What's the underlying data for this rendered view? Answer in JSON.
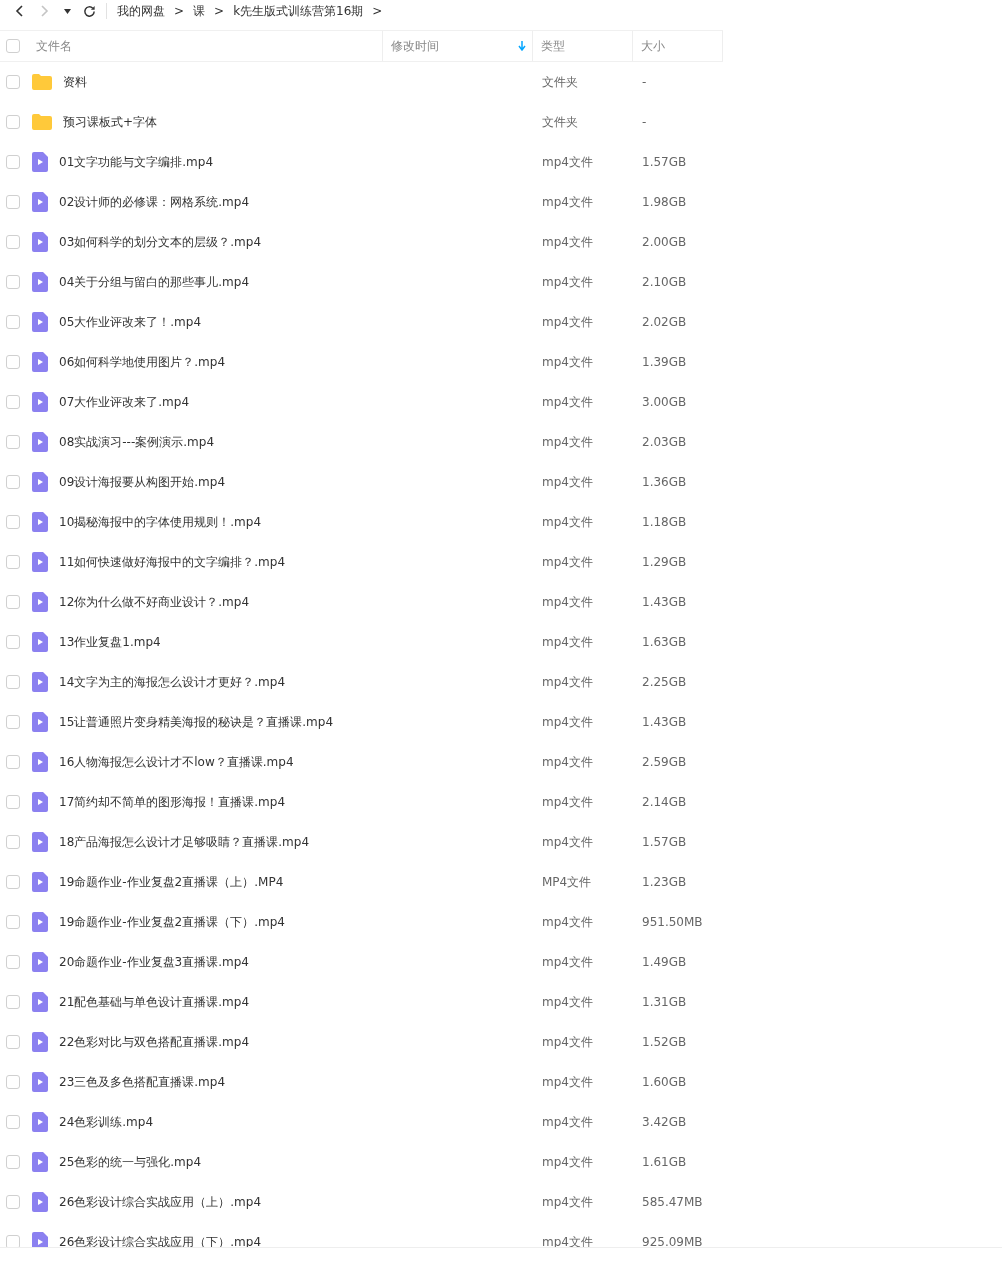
{
  "nav": {
    "back_disabled": false,
    "forward_disabled": true
  },
  "breadcrumb": [
    {
      "label": "我的网盘",
      "separator": ">"
    },
    {
      "label": "课",
      "separator": ">"
    },
    {
      "label": "k先生版式训练营第16期",
      "separator": ">"
    }
  ],
  "table": {
    "all_checked": false,
    "columns": [
      {
        "label": "文件名",
        "sorted": false
      },
      {
        "label": "修改时间",
        "sorted": true
      },
      {
        "label": "类型",
        "sorted": false
      },
      {
        "label": "大小",
        "sorted": false
      }
    ],
    "rows": [
      {
        "kind": "folder",
        "checked": false,
        "name": "资料",
        "type": "文件夹",
        "size": "-"
      },
      {
        "kind": "folder",
        "checked": false,
        "name": "预习课板式+字体",
        "type": "文件夹",
        "size": "-"
      },
      {
        "kind": "video",
        "checked": false,
        "name": "01文字功能与文字编排.mp4",
        "type": "mp4文件",
        "size": "1.57GB"
      },
      {
        "kind": "video",
        "checked": false,
        "name": "02设计师的必修课：网格系统.mp4",
        "type": "mp4文件",
        "size": "1.98GB"
      },
      {
        "kind": "video",
        "checked": false,
        "name": "03如何科学的划分文本的层级？.mp4",
        "type": "mp4文件",
        "size": "2.00GB"
      },
      {
        "kind": "video",
        "checked": false,
        "name": "04关于分组与留白的那些事儿.mp4",
        "type": "mp4文件",
        "size": "2.10GB"
      },
      {
        "kind": "video",
        "checked": false,
        "name": "05大作业评改来了！.mp4",
        "type": "mp4文件",
        "size": "2.02GB"
      },
      {
        "kind": "video",
        "checked": false,
        "name": "06如何科学地使用图片？.mp4",
        "type": "mp4文件",
        "size": "1.39GB"
      },
      {
        "kind": "video",
        "checked": false,
        "name": "07大作业评改来了.mp4",
        "type": "mp4文件",
        "size": "3.00GB"
      },
      {
        "kind": "video",
        "checked": false,
        "name": "08实战演习---案例演示.mp4",
        "type": "mp4文件",
        "size": "2.03GB"
      },
      {
        "kind": "video",
        "checked": false,
        "name": "09设计海报要从构图开始.mp4",
        "type": "mp4文件",
        "size": "1.36GB"
      },
      {
        "kind": "video",
        "checked": false,
        "name": "10揭秘海报中的字体使用规则！.mp4",
        "type": "mp4文件",
        "size": "1.18GB"
      },
      {
        "kind": "video",
        "checked": false,
        "name": "11如何快速做好海报中的文字编排？.mp4",
        "type": "mp4文件",
        "size": "1.29GB"
      },
      {
        "kind": "video",
        "checked": false,
        "name": "12你为什么做不好商业设计？.mp4",
        "type": "mp4文件",
        "size": "1.43GB"
      },
      {
        "kind": "video",
        "checked": false,
        "name": "13作业复盘1.mp4",
        "type": "mp4文件",
        "size": "1.63GB"
      },
      {
        "kind": "video",
        "checked": false,
        "name": "14文字为主的海报怎么设计才更好？.mp4",
        "type": "mp4文件",
        "size": "2.25GB"
      },
      {
        "kind": "video",
        "checked": false,
        "name": "15让普通照片变身精美海报的秘诀是？直播课.mp4",
        "type": "mp4文件",
        "size": "1.43GB"
      },
      {
        "kind": "video",
        "checked": false,
        "name": "16人物海报怎么设计才不low？直播课.mp4",
        "type": "mp4文件",
        "size": "2.59GB"
      },
      {
        "kind": "video",
        "checked": false,
        "name": "17简约却不简单的图形海报！直播课.mp4",
        "type": "mp4文件",
        "size": "2.14GB"
      },
      {
        "kind": "video",
        "checked": false,
        "name": "18产品海报怎么设计才足够吸睛？直播课.mp4",
        "type": "mp4文件",
        "size": "1.57GB"
      },
      {
        "kind": "video",
        "checked": false,
        "name": "19命题作业-作业复盘2直播课（上）.MP4",
        "type": "MP4文件",
        "size": "1.23GB"
      },
      {
        "kind": "video",
        "checked": false,
        "name": "19命题作业-作业复盘2直播课（下）.mp4",
        "type": "mp4文件",
        "size": "951.50MB"
      },
      {
        "kind": "video",
        "checked": false,
        "name": "20命题作业-作业复盘3直播课.mp4",
        "type": "mp4文件",
        "size": "1.49GB"
      },
      {
        "kind": "video",
        "checked": false,
        "name": "21配色基础与单色设计直播课.mp4",
        "type": "mp4文件",
        "size": "1.31GB"
      },
      {
        "kind": "video",
        "checked": false,
        "name": "22色彩对比与双色搭配直播课.mp4",
        "type": "mp4文件",
        "size": "1.52GB"
      },
      {
        "kind": "video",
        "checked": false,
        "name": "23三色及多色搭配直播课.mp4",
        "type": "mp4文件",
        "size": "1.60GB"
      },
      {
        "kind": "video",
        "checked": false,
        "name": "24色彩训练.mp4",
        "type": "mp4文件",
        "size": "3.42GB"
      },
      {
        "kind": "video",
        "checked": false,
        "name": "25色彩的统一与强化.mp4",
        "type": "mp4文件",
        "size": "1.61GB"
      },
      {
        "kind": "video",
        "checked": false,
        "name": "26色彩设计综合实战应用（上）.mp4",
        "type": "mp4文件",
        "size": "585.47MB"
      },
      {
        "kind": "video",
        "checked": false,
        "name": "26色彩设计综合实战应用（下）.mp4",
        "type": "mp4文件",
        "size": "925.09MB"
      }
    ]
  }
}
